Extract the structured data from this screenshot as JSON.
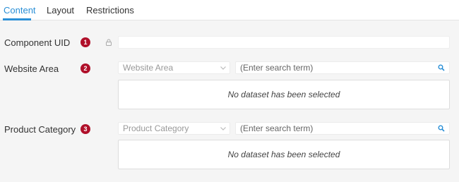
{
  "tabs": [
    {
      "label": "Content",
      "active": true
    },
    {
      "label": "Layout",
      "active": false
    },
    {
      "label": "Restrictions",
      "active": false
    }
  ],
  "fields": {
    "component_uid": {
      "label": "Component UID",
      "badge": "1",
      "value": "",
      "icon": "lock-icon"
    },
    "website_area": {
      "label": "Website Area",
      "badge": "2",
      "select_value": "Website Area",
      "search_placeholder": "(Enter search term)",
      "dataset_message": "No dataset has been selected"
    },
    "product_category": {
      "label": "Product Category",
      "badge": "3",
      "select_value": "Product Category",
      "search_placeholder": "(Enter search term)",
      "dataset_message": "No dataset has been selected"
    }
  },
  "colors": {
    "accent": "#2a8fd6",
    "badge": "#b0102a"
  }
}
